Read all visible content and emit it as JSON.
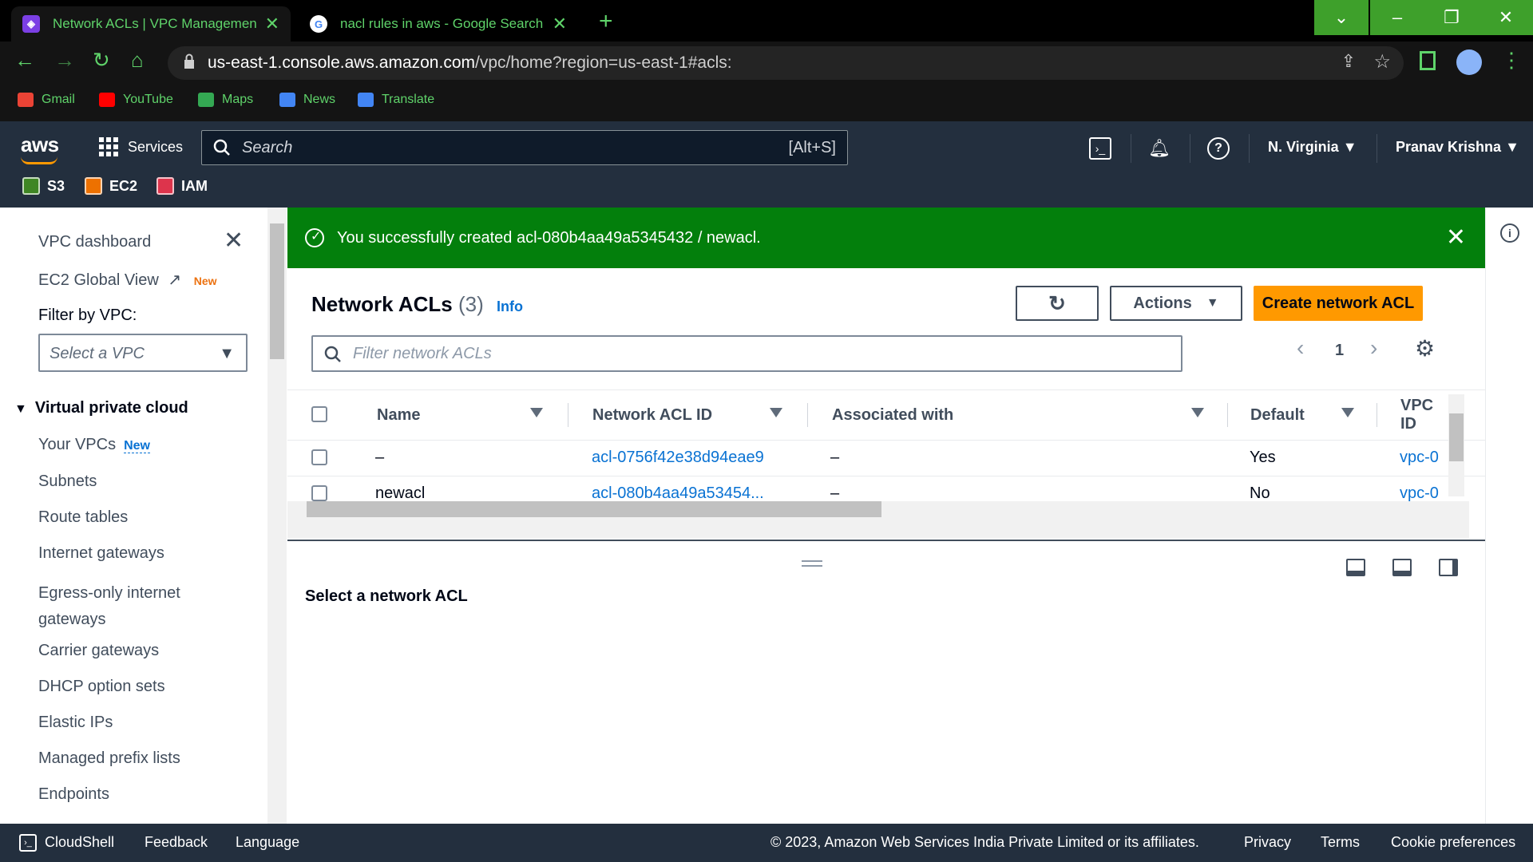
{
  "browser": {
    "tabs": [
      {
        "title": "Network ACLs | VPC Management C"
      },
      {
        "title": "nacl rules in aws - Google Search"
      }
    ],
    "url_host": "us-east-1.console.aws.amazon.com",
    "url_path": "/vpc/home?region=us-east-1#acls:",
    "bookmarks": [
      "Gmail",
      "YouTube",
      "Maps",
      "News",
      "Translate"
    ]
  },
  "aws_header": {
    "logo": "aws",
    "services": "Services",
    "search_placeholder": "Search",
    "search_shortcut": "[Alt+S]",
    "region": "N. Virginia",
    "user": "Pranav Krishna",
    "favorites": [
      "S3",
      "EC2",
      "IAM"
    ]
  },
  "sidebar": {
    "dashboard": "VPC dashboard",
    "ec2_global": "EC2 Global View",
    "new_badge": "New",
    "filter_label": "Filter by VPC:",
    "vpc_select_placeholder": "Select a VPC",
    "section": "Virtual private cloud",
    "items": [
      "Your VPCs",
      "Subnets",
      "Route tables",
      "Internet gateways",
      "Egress-only internet gateways",
      "Carrier gateways",
      "DHCP option sets",
      "Elastic IPs",
      "Managed prefix lists",
      "Endpoints"
    ]
  },
  "flash": {
    "message": "You successfully created acl-080b4aa49a5345432 / newacl."
  },
  "main": {
    "title": "Network ACLs",
    "count": "(3)",
    "info": "Info",
    "actions": "Actions",
    "create": "Create network ACL",
    "filter_placeholder": "Filter network ACLs",
    "page": "1",
    "columns": [
      "Name",
      "Network ACL ID",
      "Associated with",
      "Default",
      "VPC ID"
    ],
    "rows": [
      {
        "name": "–",
        "id": "acl-0756f42e38d94eae9",
        "assoc": "–",
        "default": "Yes",
        "vpc": "vpc-0"
      },
      {
        "name": "newacl",
        "id": "acl-080b4aa49a53454...",
        "assoc": "–",
        "default": "No",
        "vpc": "vpc-0"
      }
    ]
  },
  "split": {
    "title": "Select a network ACL"
  },
  "footer": {
    "cloudshell": "CloudShell",
    "feedback": "Feedback",
    "language": "Language",
    "copyright": "© 2023, Amazon Web Services India Private Limited or its affiliates.",
    "privacy": "Privacy",
    "terms": "Terms",
    "cookie": "Cookie preferences"
  },
  "colors": {
    "accent": "#ff9900",
    "success": "#037f0c",
    "link": "#0972d3",
    "chrome_green": "#5fd36a"
  }
}
